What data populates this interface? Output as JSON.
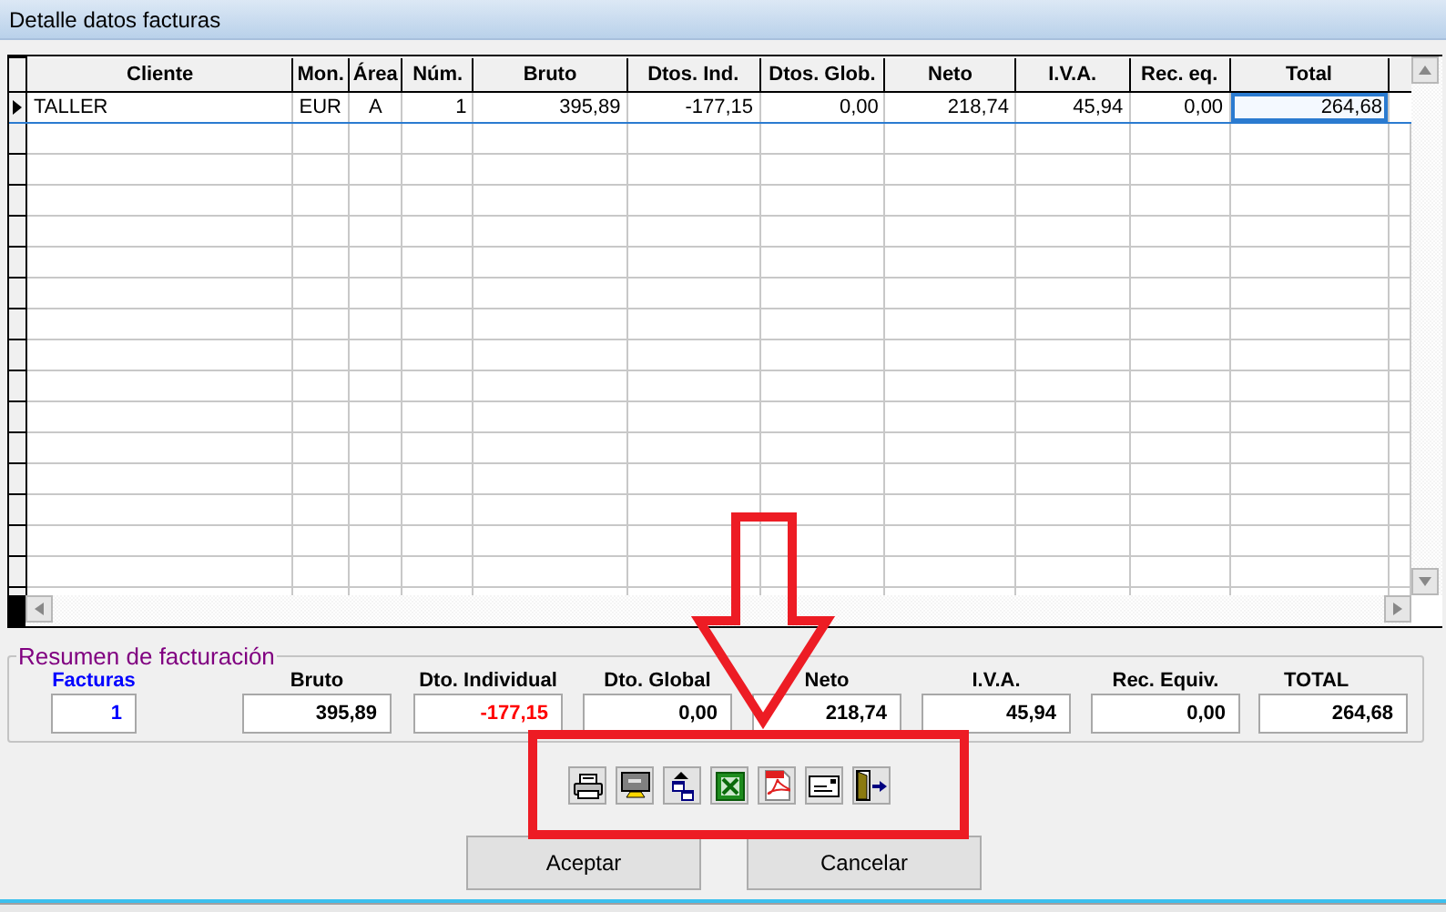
{
  "window": {
    "title": "Detalle datos facturas"
  },
  "table": {
    "columns": [
      {
        "label": "Cliente"
      },
      {
        "label": "Mon."
      },
      {
        "label": "Área"
      },
      {
        "label": "Núm."
      },
      {
        "label": "Bruto"
      },
      {
        "label": "Dtos. Ind."
      },
      {
        "label": "Dtos. Glob."
      },
      {
        "label": "Neto"
      },
      {
        "label": "I.V.A."
      },
      {
        "label": "Rec. eq."
      },
      {
        "label": "Total"
      }
    ],
    "rows": [
      {
        "selected": true,
        "cells": [
          {
            "text": "TALLER",
            "focused": false
          },
          {
            "text": "EUR",
            "focused": false
          },
          {
            "text": "A",
            "focused": false
          },
          {
            "text": "1",
            "focused": false
          },
          {
            "text": "395,89",
            "focused": false
          },
          {
            "text": "-177,15",
            "focused": false
          },
          {
            "text": "0,00",
            "focused": false
          },
          {
            "text": "218,74",
            "focused": false
          },
          {
            "text": "45,94",
            "focused": false
          },
          {
            "text": "0,00",
            "focused": false
          },
          {
            "text": "264,68",
            "focused": true
          }
        ]
      }
    ]
  },
  "summary": {
    "title": "Resumen de facturación",
    "fields": [
      {
        "label": "Facturas",
        "value": "1",
        "kind": "count"
      },
      {
        "label": "Bruto",
        "value": "395,89",
        "kind": "amount"
      },
      {
        "label": "Dto. Individual",
        "value": "-177,15",
        "kind": "negative"
      },
      {
        "label": "Dto. Global",
        "value": "0,00",
        "kind": "amount"
      },
      {
        "label": "Neto",
        "value": "218,74",
        "kind": "amount"
      },
      {
        "label": "I.V.A.",
        "value": "45,94",
        "kind": "amount"
      },
      {
        "label": "Rec. Equiv.",
        "value": "0,00",
        "kind": "amount"
      },
      {
        "label": "TOTAL",
        "value": "264,68",
        "kind": "total"
      }
    ]
  },
  "toolbar": [
    {
      "kind": "printer"
    },
    {
      "kind": "monitor"
    },
    {
      "kind": "windows"
    },
    {
      "kind": "spreadsheet"
    },
    {
      "kind": "pdf"
    },
    {
      "kind": "envelope"
    },
    {
      "kind": "exit"
    }
  ],
  "buttons": [
    "Aceptar",
    "Cancelar"
  ]
}
